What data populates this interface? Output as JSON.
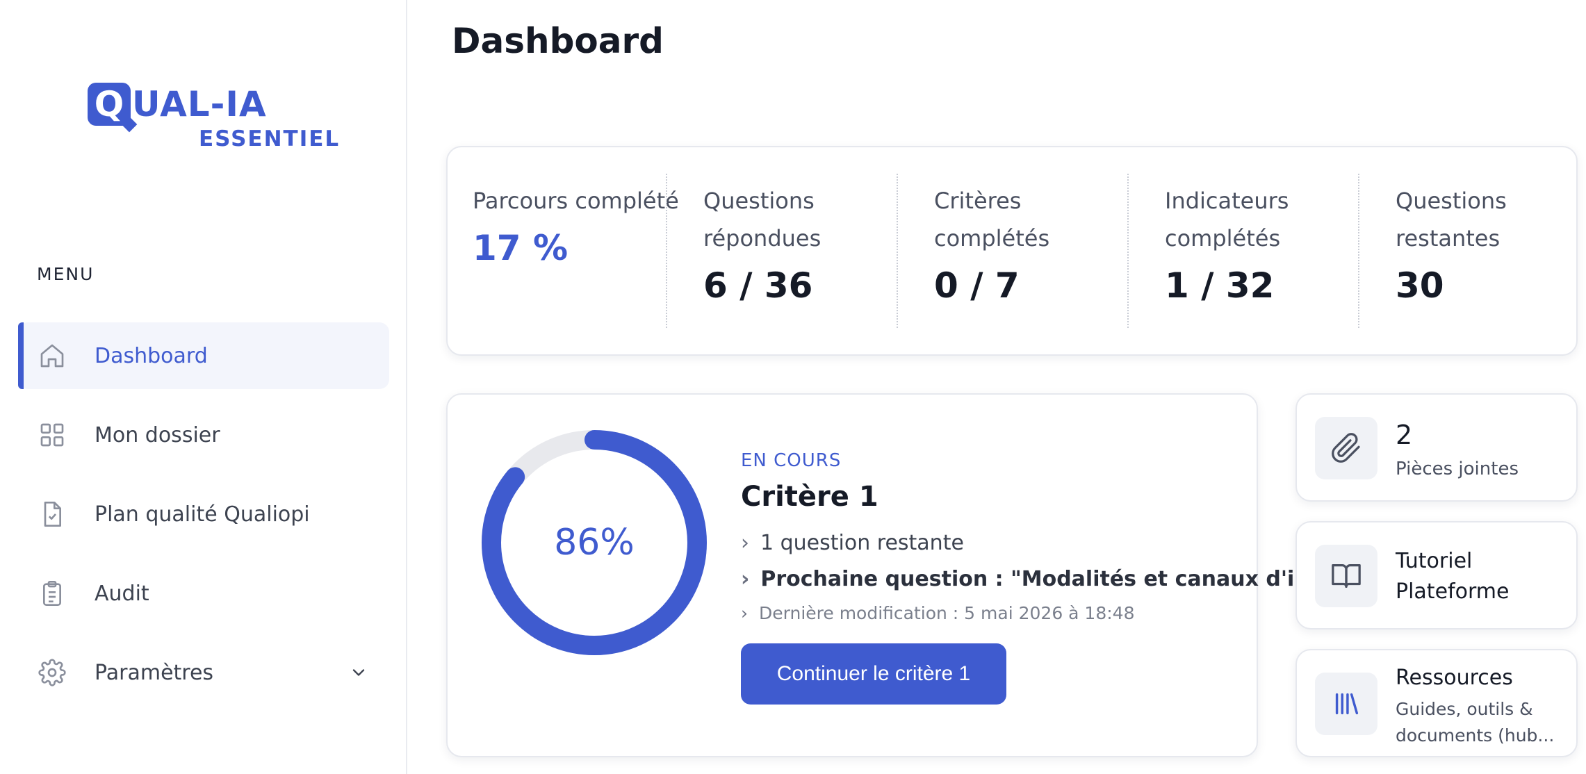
{
  "brand": {
    "logo_letter": "Q",
    "logo_rest": "UAL-IA",
    "logo_subtitle": "ESSENTIEL",
    "accent_color": "#3f5bcf"
  },
  "sidebar": {
    "menu_label": "MENU",
    "items": [
      {
        "label": "Dashboard",
        "icon": "home-icon",
        "active": true
      },
      {
        "label": "Mon dossier",
        "icon": "grid-icon",
        "active": false
      },
      {
        "label": "Plan qualité Qualiopi",
        "icon": "document-check-icon",
        "active": false
      },
      {
        "label": "Audit",
        "icon": "clipboard-icon",
        "active": false
      },
      {
        "label": "Paramètres",
        "icon": "gear-icon",
        "active": false,
        "has_submenu": true
      }
    ]
  },
  "main": {
    "title": "Dashboard",
    "stats": [
      {
        "label": "Parcours complété",
        "value": "17 %",
        "accent": true
      },
      {
        "label": "Questions répondues",
        "value": "6 / 36"
      },
      {
        "label": "Critères complétés",
        "value": "0 / 7"
      },
      {
        "label": "Indicateurs complétés",
        "value": "1 / 32"
      },
      {
        "label": "Questions restantes",
        "value": "30"
      }
    ],
    "progress": {
      "percent": 86,
      "percent_label": "86%",
      "status": "EN COURS",
      "title": "Critère 1",
      "lines": [
        "1 question restante",
        "Prochaine question : \"Modalités et canaux d'ins...",
        "Dernière modification : 5 mai 2026 à 18:48"
      ],
      "button_label": "Continuer le critère 1"
    },
    "side_cards": [
      {
        "value": "2",
        "label": "Pièces jointes",
        "icon": "paperclip-icon"
      },
      {
        "title": "Tutoriel Plateforme",
        "icon": "book-icon"
      },
      {
        "title": "Ressources",
        "description": "Guides, outils & documents (hub...",
        "icon": "library-icon"
      }
    ]
  }
}
